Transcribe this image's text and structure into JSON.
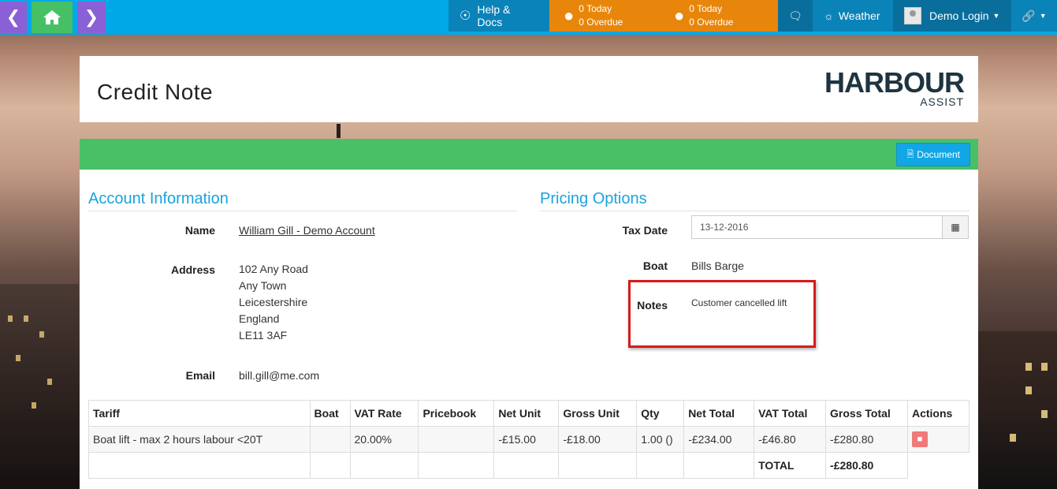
{
  "nav": {
    "back_icon": "chevron-left-icon",
    "home_icon": "home-icon",
    "forward_icon": "chevron-right-icon",
    "help_label": "Help & Docs",
    "stats": [
      {
        "icon": "person-icon",
        "today": "0 Today",
        "overdue": "0 Overdue"
      },
      {
        "icon": "people-icon",
        "today": "0 Today",
        "overdue": "0 Overdue"
      }
    ],
    "weather_label": "Weather",
    "user_label": "Demo Login",
    "colors": {
      "bar": "#00a8e8",
      "back": "#8a60d6",
      "home": "#46c065",
      "orange": "#e8860b"
    }
  },
  "header": {
    "title": "Credit Note",
    "logo_main": "HARBOUR",
    "logo_sub": "ASSIST"
  },
  "toolbar": {
    "document_label": "Document"
  },
  "account": {
    "heading": "Account Information",
    "name_label": "Name",
    "name_value": "William Gill - Demo Account",
    "address_label": "Address",
    "address_lines": [
      "102 Any Road",
      "Any Town",
      "Leicestershire",
      "England",
      "LE11 3AF"
    ],
    "email_label": "Email",
    "email_value": "bill.gill@me.com"
  },
  "pricing": {
    "heading": "Pricing Options",
    "tax_date_label": "Tax Date",
    "tax_date_value": "13-12-2016",
    "boat_label": "Boat",
    "boat_value": "Bills Barge",
    "notes_label": "Notes",
    "notes_value": "Customer cancelled lift"
  },
  "table": {
    "headers": [
      "Tariff",
      "Boat",
      "VAT Rate",
      "Pricebook",
      "Net Unit",
      "Gross Unit",
      "Qty",
      "Net Total",
      "VAT Total",
      "Gross Total",
      "Actions"
    ],
    "rows": [
      [
        "Boat lift - max 2 hours labour <20T",
        "",
        "20.00%",
        "",
        "-£15.00",
        "-£18.00",
        "1.00 ()",
        "-£234.00",
        "-£46.80",
        "-£280.80",
        ""
      ]
    ],
    "total_label": "TOTAL",
    "total_value": "-£280.80"
  }
}
